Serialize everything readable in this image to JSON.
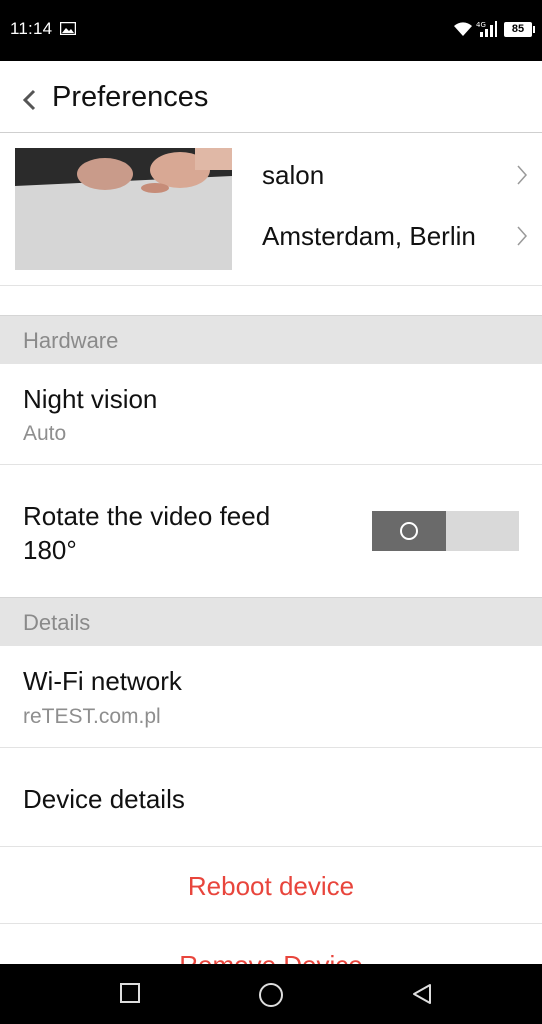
{
  "status_bar": {
    "time": "11:14",
    "battery": "85",
    "icons": [
      "image-icon",
      "wifi-icon",
      "cellular-4g-icon",
      "battery-icon"
    ]
  },
  "header": {
    "title": "Preferences"
  },
  "device": {
    "name": "salon",
    "location": "Amsterdam, Berlin"
  },
  "sections": {
    "hardware": "Hardware",
    "details": "Details"
  },
  "night_vision": {
    "label": "Night vision",
    "value": "Auto"
  },
  "rotate": {
    "label_line1": "Rotate the video feed",
    "label_line2": "180°",
    "enabled": false
  },
  "wifi": {
    "label": "Wi-Fi network",
    "value": "reTEST.com.pl"
  },
  "device_details": {
    "label": "Device details"
  },
  "actions": {
    "reboot": "Reboot device",
    "remove": "Remove Device"
  },
  "colors": {
    "accent_red": "#e8453c",
    "section_bg": "#e4e4e4",
    "toggle_off_knob": "#6a6a6a"
  }
}
